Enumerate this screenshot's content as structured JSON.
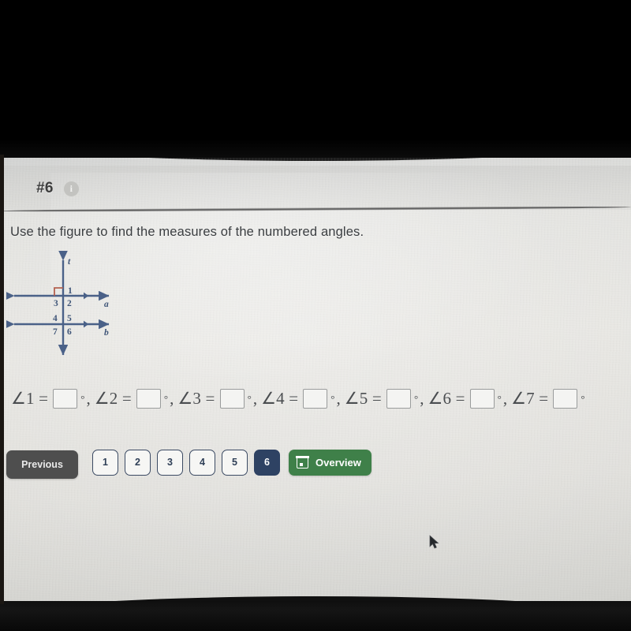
{
  "header": {
    "question_number": "#6",
    "info_icon": "info-icon"
  },
  "prompt": {
    "text": "Use the figure to find the measures of the numbered angles."
  },
  "figure": {
    "transversal_label": "t",
    "line_a_label": "a",
    "line_b_label": "b",
    "angle_numbers": {
      "n1": "1",
      "n2": "2",
      "n3": "3",
      "n4": "4",
      "n5": "5",
      "n6": "6",
      "n7": "7"
    },
    "stroke_color": "#4a6188",
    "right_angle_color": "#b4614f",
    "right_angle_marker": "right-angle-square"
  },
  "answers": {
    "degree_symbol": "°",
    "separator": ",",
    "items": [
      {
        "label": "∠1 =",
        "value": ""
      },
      {
        "label": "∠2 =",
        "value": ""
      },
      {
        "label": "∠3 =",
        "value": ""
      },
      {
        "label": "∠4 =",
        "value": ""
      },
      {
        "label": "∠5 =",
        "value": ""
      },
      {
        "label": "∠6 =",
        "value": ""
      },
      {
        "label": "∠7 =",
        "value": ""
      }
    ]
  },
  "navigation": {
    "previous_label": "Previous",
    "pages": [
      {
        "label": "1",
        "active": false
      },
      {
        "label": "2",
        "active": false
      },
      {
        "label": "3",
        "active": false
      },
      {
        "label": "4",
        "active": false
      },
      {
        "label": "5",
        "active": false
      },
      {
        "label": "6",
        "active": true
      }
    ],
    "overview_label": "Overview",
    "overview_icon": "calendar-icon",
    "overview_color": "#3f8049",
    "active_page_color": "#2e4263",
    "previous_color": "#4e4e4e"
  }
}
